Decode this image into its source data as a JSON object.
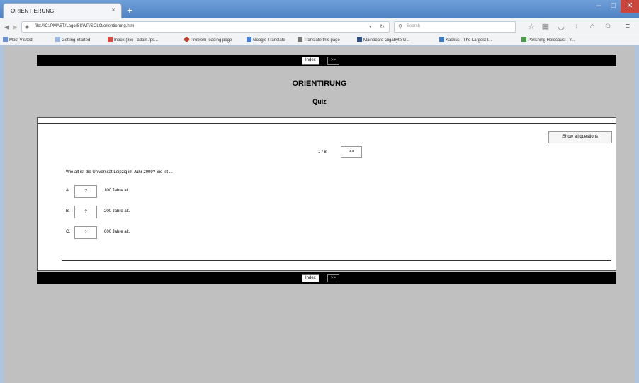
{
  "browser": {
    "tab_title": "ORIENTIERUNG",
    "tab_close": "×",
    "new_tab": "+",
    "url": "file:///C:/PMAST/Lago/SSWP/SOLO/orientierung.htm",
    "search_placeholder": "Search",
    "window_controls": {
      "minimize": "–",
      "maximize": "□",
      "close": "✕"
    },
    "bookmarks": [
      "Most Visited",
      "Getting Started",
      "Inbox (36) - adam.fps...",
      "Problem loading page",
      "Google Translate",
      "Translate this page",
      "Mainboard Gigabyte G...",
      "Kaskus - The Largest I...",
      "Perishing Holocaust | Y..."
    ]
  },
  "nav": {
    "index_label": "Index",
    "next_label": ">>"
  },
  "doc": {
    "title": "ORIENTIRUNG",
    "subtitle": "Quiz"
  },
  "quiz": {
    "show_all_label": "Show all questions",
    "counter": "1 / 8",
    "next_label": ">>",
    "question": "Wie alt ist die Universität Leipzig im Jahr 2009? Sie ist ...",
    "options": [
      {
        "letter": "A.",
        "button": "?",
        "text": "100 Jahre alt."
      },
      {
        "letter": "B.",
        "button": "?",
        "text": "200 Jahre alt."
      },
      {
        "letter": "C.",
        "button": "?",
        "text": "600 Jahre alt."
      }
    ]
  },
  "colors": {
    "chrome_blue": "#4f82c4",
    "page_gray": "#c0c0c0",
    "nav_black": "#000000"
  }
}
